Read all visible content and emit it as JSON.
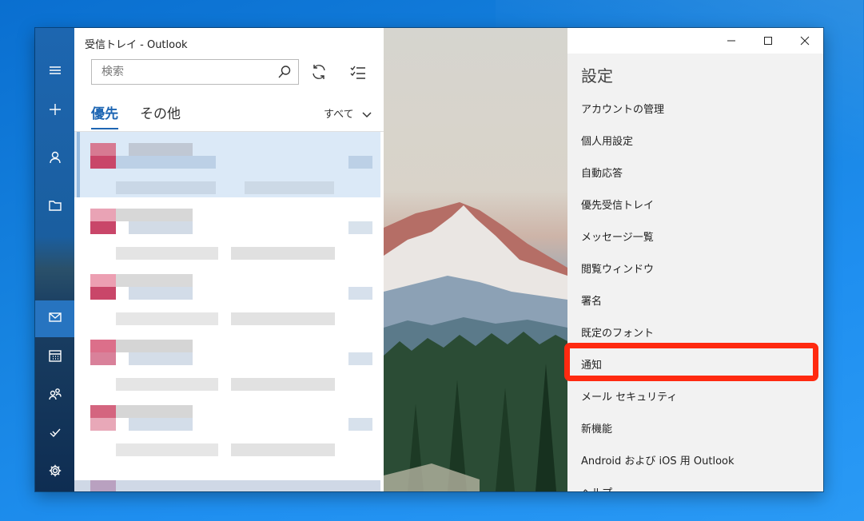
{
  "window": {
    "title": "受信トレイ - Outlook"
  },
  "rail": {
    "items": [
      {
        "icon": "hamburger-menu-icon"
      },
      {
        "icon": "plus-icon"
      },
      {
        "icon": "person-icon"
      },
      {
        "icon": "folder-icon"
      },
      {
        "icon": "mail-icon",
        "active": true
      },
      {
        "icon": "calendar-icon"
      },
      {
        "icon": "people-icon"
      },
      {
        "icon": "todo-icon"
      },
      {
        "icon": "gear-icon"
      }
    ]
  },
  "search": {
    "placeholder": "検索"
  },
  "tabs": {
    "focused": "優先",
    "other": "その他"
  },
  "filter": {
    "label": "すべて"
  },
  "settings": {
    "title": "設定",
    "items": [
      "アカウントの管理",
      "個人用設定",
      "自動応答",
      "優先受信トレイ",
      "メッセージ一覧",
      "閲覧ウィンドウ",
      "署名",
      "既定のフォント",
      "通知",
      "メール セキュリティ",
      "新機能",
      "Android および iOS 用 Outlook",
      "ヘルプ"
    ],
    "highlighted": "通知"
  },
  "colors": {
    "accent": "#1e66b3",
    "highlight": "#ff2a10",
    "rail": "#1d66b0"
  }
}
